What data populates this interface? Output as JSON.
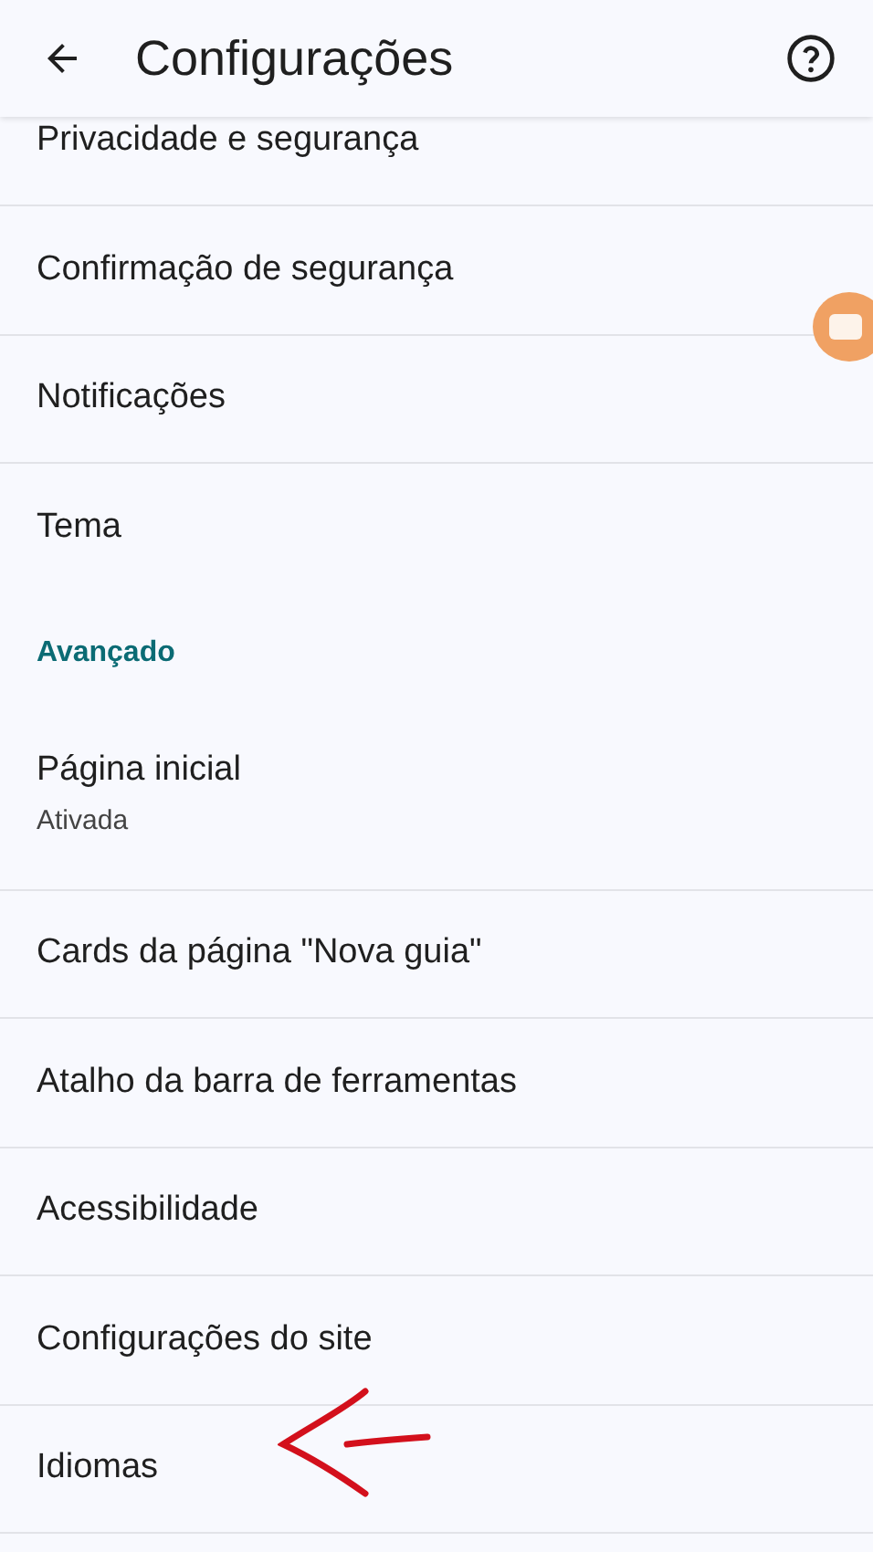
{
  "header": {
    "title": "Configurações"
  },
  "items": [
    {
      "kind": "cut",
      "label": "Privacidade e segurança"
    },
    {
      "kind": "item",
      "label": "Confirmação de segurança"
    },
    {
      "kind": "item",
      "label": "Notificações"
    },
    {
      "kind": "item",
      "label": "Tema",
      "last": true
    },
    {
      "kind": "section",
      "label": "Avançado"
    },
    {
      "kind": "item",
      "label": "Página inicial",
      "subtitle": "Ativada"
    },
    {
      "kind": "item",
      "label": "Cards da página \"Nova guia\""
    },
    {
      "kind": "item",
      "label": "Atalho da barra de ferramentas"
    },
    {
      "kind": "item",
      "label": "Acessibilidade"
    },
    {
      "kind": "item",
      "label": "Configurações do site"
    },
    {
      "kind": "item",
      "label": "Idiomas"
    }
  ]
}
